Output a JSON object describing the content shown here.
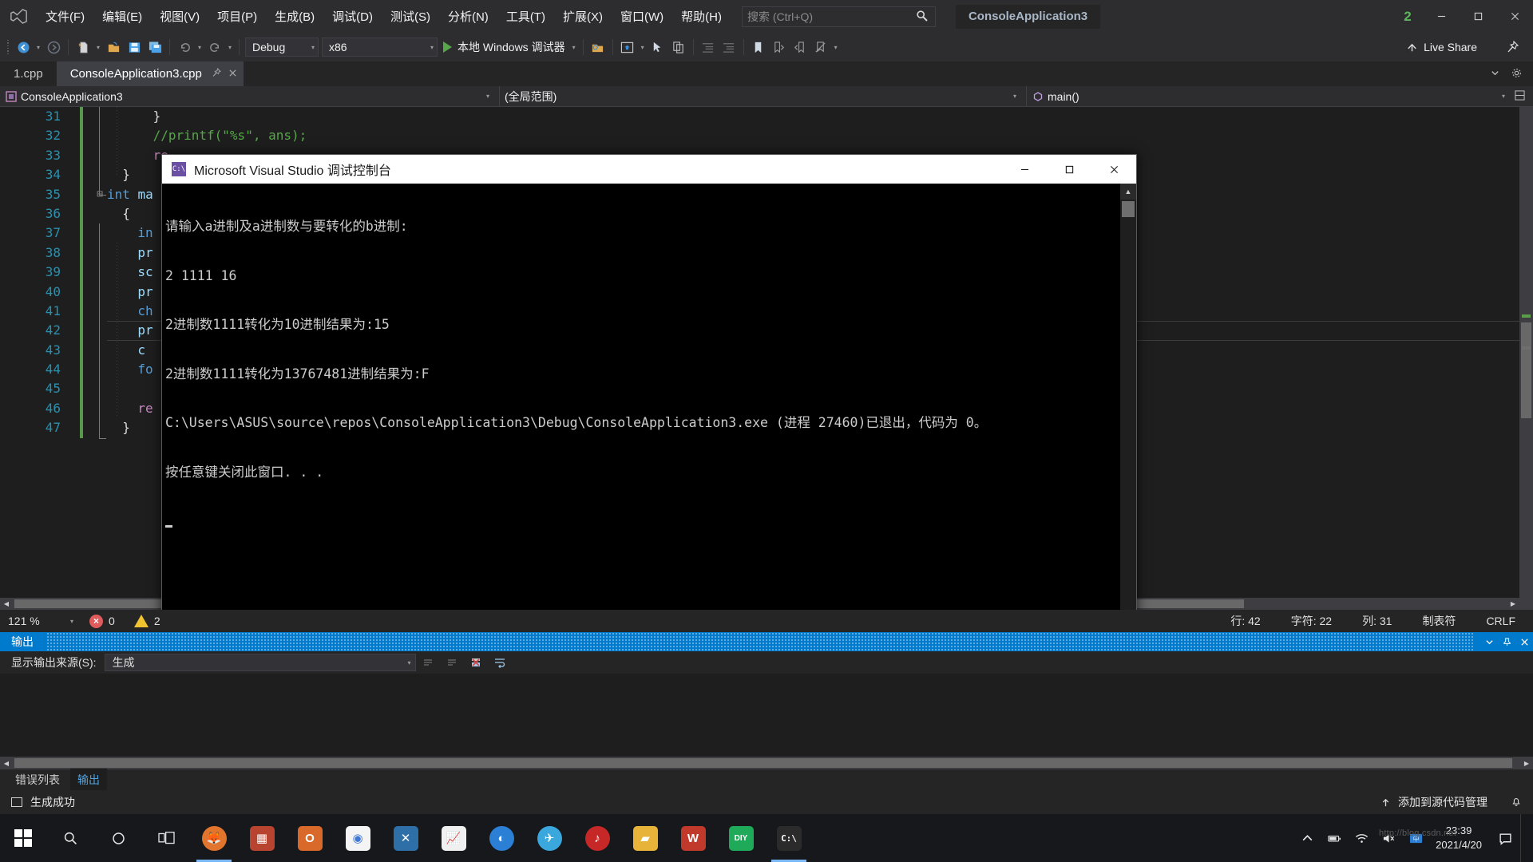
{
  "menubar": {
    "logo": "visual-studio-logo",
    "items": [
      "文件(F)",
      "编辑(E)",
      "视图(V)",
      "项目(P)",
      "生成(B)",
      "调试(D)",
      "测试(S)",
      "分析(N)",
      "工具(T)",
      "扩展(X)",
      "窗口(W)",
      "帮助(H)"
    ],
    "search_placeholder": "搜索 (Ctrl+Q)",
    "project_chip": "ConsoleApplication3",
    "notification_count": "2"
  },
  "toolbar": {
    "config": "Debug",
    "platform": "x86",
    "run_label": "本地 Windows 调试器",
    "live_share": "Live Share"
  },
  "tabs": [
    {
      "label": "1.cpp",
      "active": false
    },
    {
      "label": "ConsoleApplication3.cpp",
      "active": true
    }
  ],
  "navbar": {
    "project": "ConsoleApplication3",
    "scope": "(全局范围)",
    "member": "main()"
  },
  "editor": {
    "lines": [
      {
        "num": "31",
        "tokens": [
          {
            "t": "}",
            "c": "pl"
          }
        ],
        "indent": 6
      },
      {
        "num": "32",
        "tokens": [
          {
            "t": "//printf(\"%s\", ans);",
            "c": "cm"
          }
        ],
        "indent": 6
      },
      {
        "num": "33",
        "tokens": [
          {
            "t": "re",
            "c": "pp"
          }
        ],
        "indent": 6
      },
      {
        "num": "34",
        "tokens": [
          {
            "t": "}",
            "c": "pl"
          }
        ],
        "indent": 2
      },
      {
        "num": "35",
        "tokens": [
          {
            "t": "int ",
            "c": "kw"
          },
          {
            "t": "ma",
            "c": "vi"
          }
        ],
        "indent": 0
      },
      {
        "num": "36",
        "tokens": [
          {
            "t": "{",
            "c": "pl"
          }
        ],
        "indent": 2
      },
      {
        "num": "37",
        "tokens": [
          {
            "t": "in",
            "c": "kw"
          }
        ],
        "indent": 4
      },
      {
        "num": "38",
        "tokens": [
          {
            "t": "pr",
            "c": "vi"
          }
        ],
        "indent": 4
      },
      {
        "num": "39",
        "tokens": [
          {
            "t": "sc",
            "c": "vi"
          }
        ],
        "indent": 4
      },
      {
        "num": "40",
        "tokens": [
          {
            "t": "pr",
            "c": "vi"
          }
        ],
        "indent": 4
      },
      {
        "num": "41",
        "tokens": [
          {
            "t": "ch",
            "c": "kw"
          }
        ],
        "indent": 4
      },
      {
        "num": "42",
        "tokens": [
          {
            "t": "pr",
            "c": "vi"
          }
        ],
        "indent": 4
      },
      {
        "num": "43",
        "tokens": [
          {
            "t": "c",
            "c": "vi"
          }
        ],
        "indent": 4
      },
      {
        "num": "44",
        "tokens": [
          {
            "t": "fo",
            "c": "kw"
          }
        ],
        "indent": 4
      },
      {
        "num": "45",
        "tokens": [],
        "indent": 4
      },
      {
        "num": "46",
        "tokens": [
          {
            "t": "re",
            "c": "pp"
          }
        ],
        "indent": 4
      },
      {
        "num": "47",
        "tokens": [
          {
            "t": "}",
            "c": "pl"
          }
        ],
        "indent": 2
      }
    ],
    "caret_line_index": 11
  },
  "console": {
    "title": "Microsoft Visual Studio 调试控制台",
    "icon_text": "C:\\",
    "lines": [
      "请输入a进制及a进制数与要转化的b进制:",
      "2 1111 16",
      "2进制数1111转化为10进制结果为:15",
      "2进制数1111转化为13767481进制结果为:F",
      "C:\\Users\\ASUS\\source\\repos\\ConsoleApplication3\\Debug\\ConsoleApplication3.exe (进程 27460)已退出，代码为 0。",
      "按任意键关闭此窗口. . ."
    ],
    "minimize_label": "最小化",
    "maximize_label": "最大化",
    "close_label": "关闭"
  },
  "zoomstrip": {
    "zoom": "121 %",
    "errors": "0",
    "warnings": "2",
    "line": "行: 42",
    "char": "字符: 22",
    "col": "列: 31",
    "tabmode": "制表符",
    "lineending": "CRLF"
  },
  "output": {
    "title": "输出",
    "source_label": "显示输出来源(S):",
    "source_value": "生成"
  },
  "bottom_tabs": [
    {
      "label": "错误列表",
      "active": false
    },
    {
      "label": "输出",
      "active": true
    }
  ],
  "statusbar": {
    "ready": "生成成功",
    "source_control": "添加到源代码管理"
  },
  "taskbar": {
    "apps": [
      {
        "name": "taskview",
        "glyph": "▤",
        "color": "transparent",
        "letter": ""
      },
      {
        "name": "firefox",
        "glyph": "",
        "color": "#e2752e",
        "letter": "🦊"
      },
      {
        "name": "store",
        "glyph": "",
        "color": "#c0392b",
        "letter": "▦"
      },
      {
        "name": "outlook",
        "glyph": "",
        "color": "#d9692a",
        "letter": "O"
      },
      {
        "name": "chrome",
        "glyph": "",
        "color": "#ffffff",
        "letter": "◉"
      },
      {
        "name": "vscode",
        "glyph": "",
        "color": "#2f6fa8",
        "letter": "✕"
      },
      {
        "name": "charts",
        "glyph": "",
        "color": "#3a7d3a",
        "letter": "📈"
      },
      {
        "name": "blue-app",
        "glyph": "",
        "color": "#2b7fd4",
        "letter": "◐"
      },
      {
        "name": "telegram",
        "glyph": "",
        "color": "#3aa7dd",
        "letter": "✈"
      },
      {
        "name": "netease-music",
        "glyph": "",
        "color": "#c62828",
        "letter": "♪"
      },
      {
        "name": "file-explorer",
        "glyph": "",
        "color": "#e8b339",
        "letter": "▰"
      },
      {
        "name": "wps",
        "glyph": "",
        "color": "#c0392b",
        "letter": "W"
      },
      {
        "name": "diy-app",
        "glyph": "",
        "color": "#1faa5a",
        "letter": "DIY"
      },
      {
        "name": "visual-studio",
        "glyph": "",
        "color": "#5a4a8a",
        "letter": "C:\\"
      }
    ],
    "time": "23:39",
    "date": "2021/4/20",
    "watermark": "http://blog.csdn.net"
  }
}
